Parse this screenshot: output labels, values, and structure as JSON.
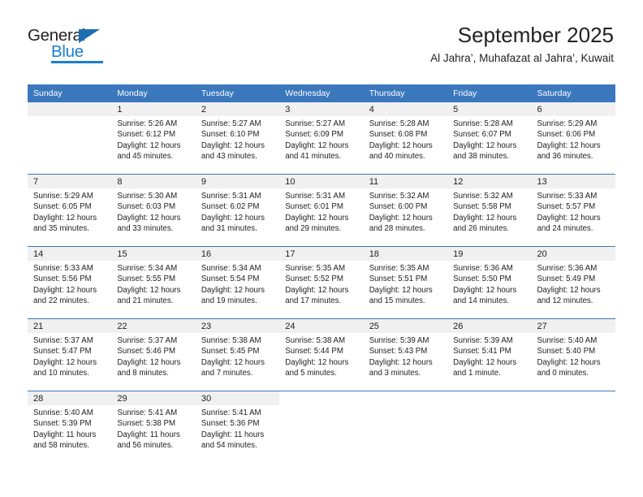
{
  "brand": {
    "name_primary": "General",
    "name_secondary": "Blue"
  },
  "header": {
    "title": "September 2025",
    "subtitle": "Al Jahra’, Muhafazat al Jahra’, Kuwait"
  },
  "colors": {
    "header_blue": "#3b77bd",
    "brand_blue": "#1a7fd4",
    "daynum_band": "#f0f0f0",
    "text": "#222222"
  },
  "calendar": {
    "weekday_headers": [
      "Sunday",
      "Monday",
      "Tuesday",
      "Wednesday",
      "Thursday",
      "Friday",
      "Saturday"
    ],
    "weeks": [
      [
        {
          "day": "",
          "sunrise": "",
          "sunset": "",
          "daylight_line1": "",
          "daylight_line2": ""
        },
        {
          "day": "1",
          "sunrise": "Sunrise: 5:26 AM",
          "sunset": "Sunset: 6:12 PM",
          "daylight_line1": "Daylight: 12 hours",
          "daylight_line2": "and 45 minutes."
        },
        {
          "day": "2",
          "sunrise": "Sunrise: 5:27 AM",
          "sunset": "Sunset: 6:10 PM",
          "daylight_line1": "Daylight: 12 hours",
          "daylight_line2": "and 43 minutes."
        },
        {
          "day": "3",
          "sunrise": "Sunrise: 5:27 AM",
          "sunset": "Sunset: 6:09 PM",
          "daylight_line1": "Daylight: 12 hours",
          "daylight_line2": "and 41 minutes."
        },
        {
          "day": "4",
          "sunrise": "Sunrise: 5:28 AM",
          "sunset": "Sunset: 6:08 PM",
          "daylight_line1": "Daylight: 12 hours",
          "daylight_line2": "and 40 minutes."
        },
        {
          "day": "5",
          "sunrise": "Sunrise: 5:28 AM",
          "sunset": "Sunset: 6:07 PM",
          "daylight_line1": "Daylight: 12 hours",
          "daylight_line2": "and 38 minutes."
        },
        {
          "day": "6",
          "sunrise": "Sunrise: 5:29 AM",
          "sunset": "Sunset: 6:06 PM",
          "daylight_line1": "Daylight: 12 hours",
          "daylight_line2": "and 36 minutes."
        }
      ],
      [
        {
          "day": "7",
          "sunrise": "Sunrise: 5:29 AM",
          "sunset": "Sunset: 6:05 PM",
          "daylight_line1": "Daylight: 12 hours",
          "daylight_line2": "and 35 minutes."
        },
        {
          "day": "8",
          "sunrise": "Sunrise: 5:30 AM",
          "sunset": "Sunset: 6:03 PM",
          "daylight_line1": "Daylight: 12 hours",
          "daylight_line2": "and 33 minutes."
        },
        {
          "day": "9",
          "sunrise": "Sunrise: 5:31 AM",
          "sunset": "Sunset: 6:02 PM",
          "daylight_line1": "Daylight: 12 hours",
          "daylight_line2": "and 31 minutes."
        },
        {
          "day": "10",
          "sunrise": "Sunrise: 5:31 AM",
          "sunset": "Sunset: 6:01 PM",
          "daylight_line1": "Daylight: 12 hours",
          "daylight_line2": "and 29 minutes."
        },
        {
          "day": "11",
          "sunrise": "Sunrise: 5:32 AM",
          "sunset": "Sunset: 6:00 PM",
          "daylight_line1": "Daylight: 12 hours",
          "daylight_line2": "and 28 minutes."
        },
        {
          "day": "12",
          "sunrise": "Sunrise: 5:32 AM",
          "sunset": "Sunset: 5:58 PM",
          "daylight_line1": "Daylight: 12 hours",
          "daylight_line2": "and 26 minutes."
        },
        {
          "day": "13",
          "sunrise": "Sunrise: 5:33 AM",
          "sunset": "Sunset: 5:57 PM",
          "daylight_line1": "Daylight: 12 hours",
          "daylight_line2": "and 24 minutes."
        }
      ],
      [
        {
          "day": "14",
          "sunrise": "Sunrise: 5:33 AM",
          "sunset": "Sunset: 5:56 PM",
          "daylight_line1": "Daylight: 12 hours",
          "daylight_line2": "and 22 minutes."
        },
        {
          "day": "15",
          "sunrise": "Sunrise: 5:34 AM",
          "sunset": "Sunset: 5:55 PM",
          "daylight_line1": "Daylight: 12 hours",
          "daylight_line2": "and 21 minutes."
        },
        {
          "day": "16",
          "sunrise": "Sunrise: 5:34 AM",
          "sunset": "Sunset: 5:54 PM",
          "daylight_line1": "Daylight: 12 hours",
          "daylight_line2": "and 19 minutes."
        },
        {
          "day": "17",
          "sunrise": "Sunrise: 5:35 AM",
          "sunset": "Sunset: 5:52 PM",
          "daylight_line1": "Daylight: 12 hours",
          "daylight_line2": "and 17 minutes."
        },
        {
          "day": "18",
          "sunrise": "Sunrise: 5:35 AM",
          "sunset": "Sunset: 5:51 PM",
          "daylight_line1": "Daylight: 12 hours",
          "daylight_line2": "and 15 minutes."
        },
        {
          "day": "19",
          "sunrise": "Sunrise: 5:36 AM",
          "sunset": "Sunset: 5:50 PM",
          "daylight_line1": "Daylight: 12 hours",
          "daylight_line2": "and 14 minutes."
        },
        {
          "day": "20",
          "sunrise": "Sunrise: 5:36 AM",
          "sunset": "Sunset: 5:49 PM",
          "daylight_line1": "Daylight: 12 hours",
          "daylight_line2": "and 12 minutes."
        }
      ],
      [
        {
          "day": "21",
          "sunrise": "Sunrise: 5:37 AM",
          "sunset": "Sunset: 5:47 PM",
          "daylight_line1": "Daylight: 12 hours",
          "daylight_line2": "and 10 minutes."
        },
        {
          "day": "22",
          "sunrise": "Sunrise: 5:37 AM",
          "sunset": "Sunset: 5:46 PM",
          "daylight_line1": "Daylight: 12 hours",
          "daylight_line2": "and 8 minutes."
        },
        {
          "day": "23",
          "sunrise": "Sunrise: 5:38 AM",
          "sunset": "Sunset: 5:45 PM",
          "daylight_line1": "Daylight: 12 hours",
          "daylight_line2": "and 7 minutes."
        },
        {
          "day": "24",
          "sunrise": "Sunrise: 5:38 AM",
          "sunset": "Sunset: 5:44 PM",
          "daylight_line1": "Daylight: 12 hours",
          "daylight_line2": "and 5 minutes."
        },
        {
          "day": "25",
          "sunrise": "Sunrise: 5:39 AM",
          "sunset": "Sunset: 5:43 PM",
          "daylight_line1": "Daylight: 12 hours",
          "daylight_line2": "and 3 minutes."
        },
        {
          "day": "26",
          "sunrise": "Sunrise: 5:39 AM",
          "sunset": "Sunset: 5:41 PM",
          "daylight_line1": "Daylight: 12 hours",
          "daylight_line2": "and 1 minute."
        },
        {
          "day": "27",
          "sunrise": "Sunrise: 5:40 AM",
          "sunset": "Sunset: 5:40 PM",
          "daylight_line1": "Daylight: 12 hours",
          "daylight_line2": "and 0 minutes."
        }
      ],
      [
        {
          "day": "28",
          "sunrise": "Sunrise: 5:40 AM",
          "sunset": "Sunset: 5:39 PM",
          "daylight_line1": "Daylight: 11 hours",
          "daylight_line2": "and 58 minutes."
        },
        {
          "day": "29",
          "sunrise": "Sunrise: 5:41 AM",
          "sunset": "Sunset: 5:38 PM",
          "daylight_line1": "Daylight: 11 hours",
          "daylight_line2": "and 56 minutes."
        },
        {
          "day": "30",
          "sunrise": "Sunrise: 5:41 AM",
          "sunset": "Sunset: 5:36 PM",
          "daylight_line1": "Daylight: 11 hours",
          "daylight_line2": "and 54 minutes."
        },
        {
          "day": "",
          "sunrise": "",
          "sunset": "",
          "daylight_line1": "",
          "daylight_line2": ""
        },
        {
          "day": "",
          "sunrise": "",
          "sunset": "",
          "daylight_line1": "",
          "daylight_line2": ""
        },
        {
          "day": "",
          "sunrise": "",
          "sunset": "",
          "daylight_line1": "",
          "daylight_line2": ""
        },
        {
          "day": "",
          "sunrise": "",
          "sunset": "",
          "daylight_line1": "",
          "daylight_line2": ""
        }
      ]
    ]
  }
}
